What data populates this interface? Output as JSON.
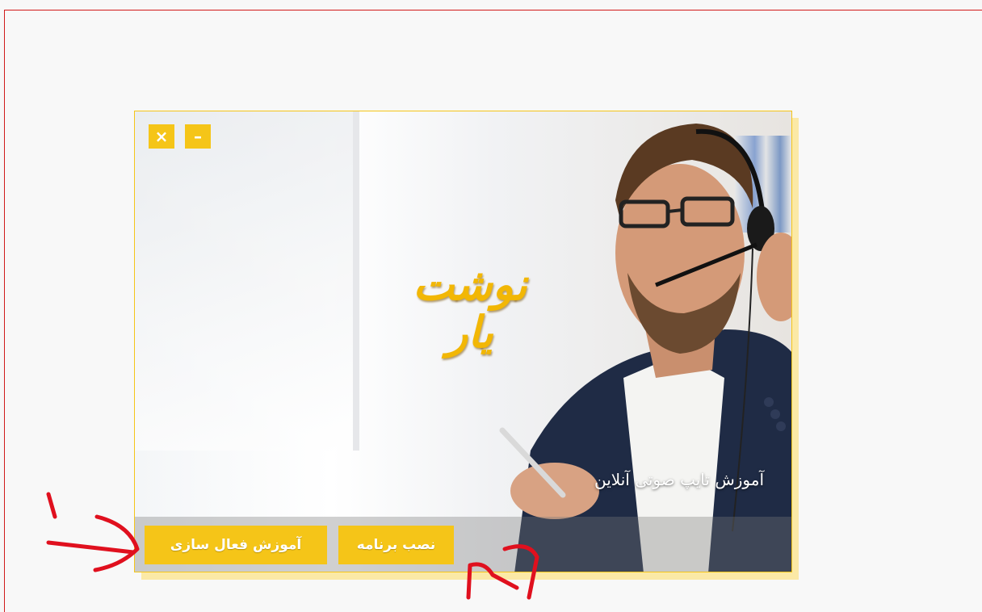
{
  "window": {
    "logo_text": "نوشت یار",
    "subtitle": "آموزش تایپ صوتی آنلاین",
    "controls": {
      "close_symbol": "×",
      "minimize_symbol": "–"
    },
    "buttons": {
      "activation_tutorial": "آموزش فعال سازی",
      "install_program": "نصب برنامه"
    }
  },
  "annotations": {
    "marker_1": "1",
    "marker_2": "2",
    "color": "#e0101e"
  },
  "colors": {
    "accent": "#f5c518",
    "frame_border": "#d11a1a"
  }
}
